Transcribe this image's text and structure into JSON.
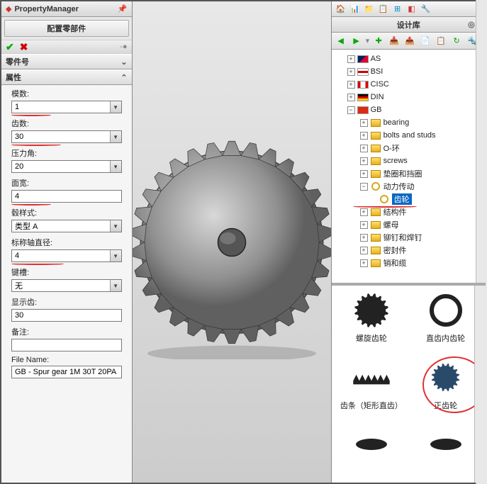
{
  "pm": {
    "title": "PropertyManager",
    "subtitle": "配置零部件",
    "section_part": "零件号",
    "section_props": "属性",
    "fields": {
      "modulus": {
        "label": "模数:",
        "value": "1"
      },
      "teeth": {
        "label": "齿数:",
        "value": "30"
      },
      "pressure_angle": {
        "label": "压力角:",
        "value": "20"
      },
      "face_width": {
        "label": "面宽:",
        "value": "4"
      },
      "hub_style": {
        "label": "毂样式:",
        "value": "类型 A"
      },
      "nom_shaft_dia": {
        "label": "标称轴直径:",
        "value": "4"
      },
      "keyway": {
        "label": "键槽:",
        "value": "无"
      },
      "show_teeth": {
        "label": "显示齿:",
        "value": "30"
      },
      "notes": {
        "label": "备注:",
        "value": ""
      },
      "filename": {
        "label": "File Name:",
        "value": "GB - Spur gear 1M 30T 20PA"
      }
    }
  },
  "lib": {
    "title": "设计库",
    "tree": {
      "as": "AS",
      "bsi": "BSI",
      "cisc": "CISC",
      "din": "DIN",
      "gb": "GB",
      "bearing": "bearing",
      "bolts": "bolts and studs",
      "oring": "O-环",
      "screws": "screws",
      "washers": "垫圈和挡圈",
      "power": "动力传动",
      "gears": "齿轮",
      "struct": "结构件",
      "nuts": "螺母",
      "rivets": "铆钉和焊钉",
      "seals": "密封件",
      "pins": "销和缆"
    },
    "previews": {
      "helical": "螺旋齿轮",
      "internal": "直齿内齿轮",
      "rack": "齿条（矩形直齿）",
      "spur": "正齿轮"
    }
  }
}
